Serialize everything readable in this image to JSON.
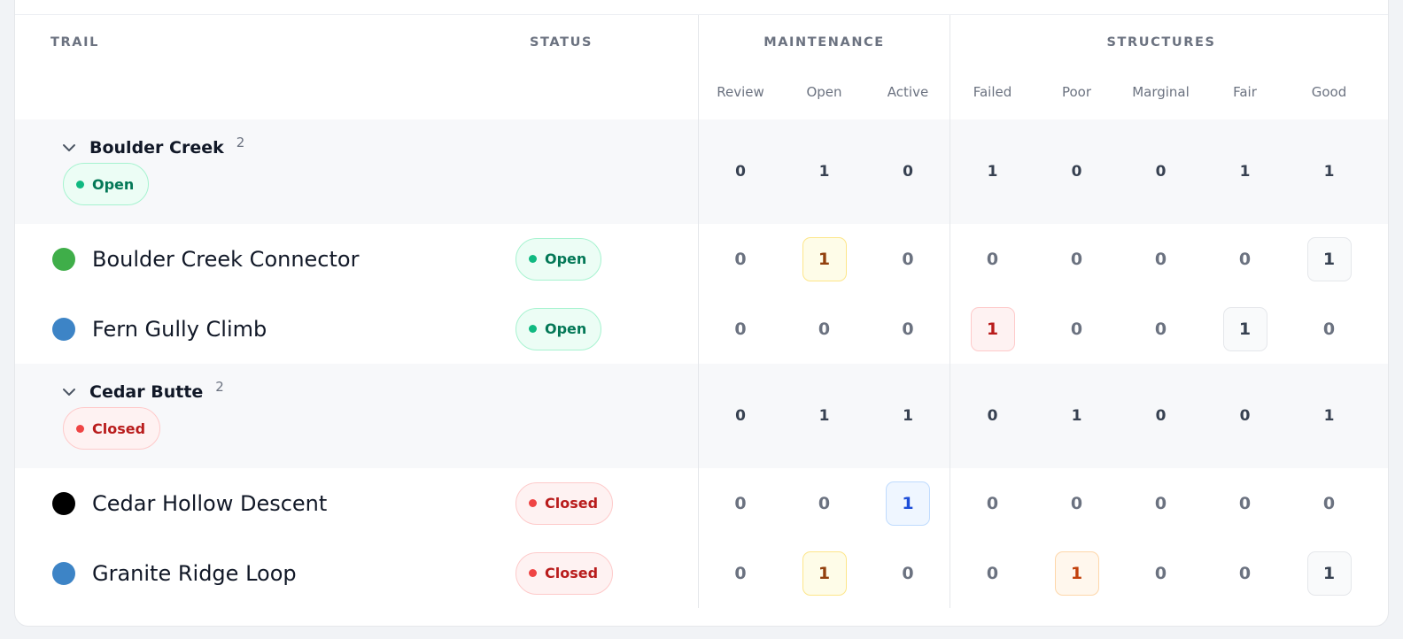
{
  "headers": {
    "trail": "TRAIL",
    "status": "STATUS",
    "maintenance": "MAINTENANCE",
    "structures": "STRUCTURES",
    "sub": [
      "Review",
      "Open",
      "Active",
      "Failed",
      "Poor",
      "Marginal",
      "Fair",
      "Good"
    ]
  },
  "groups": [
    {
      "name": "Boulder Creek",
      "count": "2",
      "status": "Open",
      "totals": [
        "0",
        "1",
        "0",
        "1",
        "0",
        "0",
        "1",
        "1"
      ],
      "trails": [
        {
          "name": "Boulder Creek Connector",
          "dot_color": "#3fae49",
          "status": "Open",
          "values": [
            "0",
            "1",
            "0",
            "0",
            "0",
            "0",
            "0",
            "1"
          ],
          "highlight": [
            "",
            "yellow",
            "",
            "",
            "",
            "",
            "",
            "gray"
          ]
        },
        {
          "name": "Fern Gully Climb",
          "dot_color": "#3d84c6",
          "status": "Open",
          "values": [
            "0",
            "0",
            "0",
            "1",
            "0",
            "0",
            "1",
            "0"
          ],
          "highlight": [
            "",
            "",
            "",
            "red",
            "",
            "",
            "gray",
            ""
          ]
        }
      ]
    },
    {
      "name": "Cedar Butte",
      "count": "2",
      "status": "Closed",
      "totals": [
        "0",
        "1",
        "1",
        "0",
        "1",
        "0",
        "0",
        "1"
      ],
      "trails": [
        {
          "name": "Cedar Hollow Descent",
          "dot_color": "#000000",
          "status": "Closed",
          "values": [
            "0",
            "0",
            "1",
            "0",
            "0",
            "0",
            "0",
            "0"
          ],
          "highlight": [
            "",
            "",
            "blue",
            "",
            "",
            "",
            "",
            ""
          ]
        },
        {
          "name": "Granite Ridge Loop",
          "dot_color": "#3d84c6",
          "status": "Closed",
          "values": [
            "0",
            "1",
            "0",
            "0",
            "1",
            "0",
            "0",
            "1"
          ],
          "highlight": [
            "",
            "yellow",
            "",
            "",
            "orange",
            "",
            "",
            "gray"
          ]
        }
      ]
    }
  ]
}
